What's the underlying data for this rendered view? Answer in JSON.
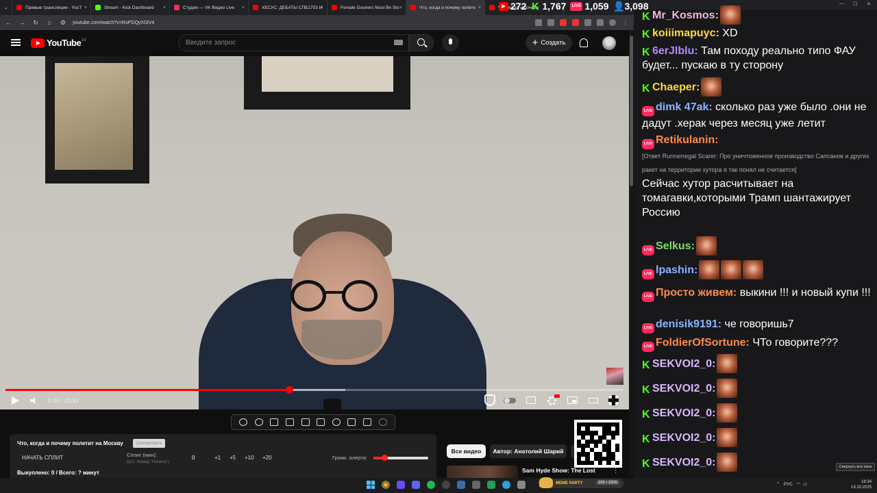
{
  "browser": {
    "tabs": [
      {
        "label": "Прямые трансляции - YouT",
        "color": "#ff0000"
      },
      {
        "label": "Stream - Kick Dashboard",
        "color": "#53fc18"
      },
      {
        "label": "Студия — VK Видео Live",
        "color": "#ff2b5e"
      },
      {
        "label": "ХЕСУС: ДЕБАТЫ СПБ1703 И",
        "color": "#ff0000"
      },
      {
        "label": "Female Gooners Must Be Sto",
        "color": "#ff0000"
      },
      {
        "label": "Что, когда и почему полете",
        "color": "#ff0000",
        "active": true
      },
      {
        "label": "Что, когда и почему",
        "color": "#ff0000"
      }
    ],
    "url": "youtube.com/watch?v=RoPDQyXDiV4"
  },
  "stats": {
    "youtube_viewers": "272",
    "kick_viewers": "1,767",
    "vk_viewers": "1,059",
    "total_viewers": "3,098"
  },
  "youtube": {
    "logo": "YouTube",
    "region": "LV",
    "search_placeholder": "Введите запрос",
    "create_label": "Создать",
    "player": {
      "time": "9:36 / 20:53",
      "progress": 0.459,
      "buffered": 0.55
    }
  },
  "split": {
    "title": "Что, когда и почему полетит на Москву",
    "copy_label": "Скопировать",
    "start_label": "НАЧАТЬ СПЛИТ",
    "minutes_label": "Сплит (мин):",
    "hint": "(уст. перед \"Начать\")",
    "value": "0",
    "adds": [
      "+1",
      "+5",
      "+10",
      "+20"
    ],
    "alert_label": "Громк. алерта:",
    "alert_volume": 0.2,
    "status": "Выкуплено: 0 / Всего: ? минут"
  },
  "recommendations": {
    "chip_all": "Все видео",
    "chip_author": "Автор: Анатолий Шарий",
    "first_title": "Sam Hyde Show: The Lost"
  },
  "chat": {
    "messages": [
      {
        "platform": "kick",
        "nick": "Mr_Kosmos:",
        "color": "#f1b9d4",
        "text": "",
        "emotes": 1
      },
      {
        "platform": "kick",
        "nick": "koiiimapuyc:",
        "color": "#ffd83b",
        "text": "XD",
        "emotes": 0
      },
      {
        "platform": "kick",
        "nick": "6erJlblu:",
        "color": "#b18bff",
        "text": "Там походу реально типо ФАУ будет... пускаю в ту сторону",
        "emotes": 0
      },
      {
        "platform": "kick",
        "nick": "Chaeper:",
        "color": "#ffd83b",
        "text": "",
        "emotes": 1
      },
      {
        "platform": "vk",
        "nick": "dimk 47ak:",
        "color": "#8ab4ff",
        "text": "сколько раз уже было .они не дадут .херак через месяц уже летит",
        "emotes": 0
      },
      {
        "platform": "vk",
        "nick": "Retikulanin:",
        "color": "#ff8a4c",
        "reply": "[Ответ Runnerregal Scarer: Про уничтоженное производство Сапсанов и других ракет на территории хутора я так понял не считается]",
        "text": "Сейчас хутор расчитывает на томагавки,которыми Трамп шантажирует Россию",
        "emotes": 0
      },
      {
        "platform": "vk",
        "nick": "Selkus:",
        "color": "#7ddc6b",
        "text": "",
        "emotes": 1
      },
      {
        "platform": "vk",
        "nick": "lpashin:",
        "color": "#8ab4ff",
        "text": "",
        "emotes": 3
      },
      {
        "platform": "vk",
        "nick": "Просто живем:",
        "color": "#ff8a4c",
        "text": "выкини !!! и новый купи !!!",
        "emotes": 0
      },
      {
        "platform": "vk",
        "nick": "denisik9191:",
        "color": "#8ab4ff",
        "text": "че говоришь7",
        "emotes": 0
      },
      {
        "platform": "vk",
        "nick": "FoldierOfSortune:",
        "color": "#ff8a4c",
        "text": "ЧТо говорите???",
        "emotes": 0
      },
      {
        "platform": "kick",
        "nick": "SEKVOI2_0:",
        "color": "#d9b8ff",
        "text": "",
        "emotes": 1
      },
      {
        "platform": "kick",
        "nick": "SEKVOI2_0:",
        "color": "#d9b8ff",
        "text": "",
        "emotes": 1
      },
      {
        "platform": "kick",
        "nick": "SEKVOI2_0:",
        "color": "#d9b8ff",
        "text": "",
        "emotes": 1
      },
      {
        "platform": "kick",
        "nick": "SEKVOI2_0:",
        "color": "#d9b8ff",
        "text": "",
        "emotes": 1
      },
      {
        "platform": "kick",
        "nick": "SEKVOI2_0:",
        "color": "#d9b8ff",
        "text": "",
        "emotes": 1
      }
    ],
    "tooltip": "Свернуть все окна"
  },
  "taskbar": {
    "meme_label": "MEME PARTY",
    "meme_count": "100 / 1500",
    "lang": "РУС",
    "time": "18:34",
    "date": "13.10.2025"
  },
  "colors": {
    "youtube_red": "#ff0000",
    "kick_green": "#53fc18",
    "vk_pink": "#ff2b5e"
  }
}
